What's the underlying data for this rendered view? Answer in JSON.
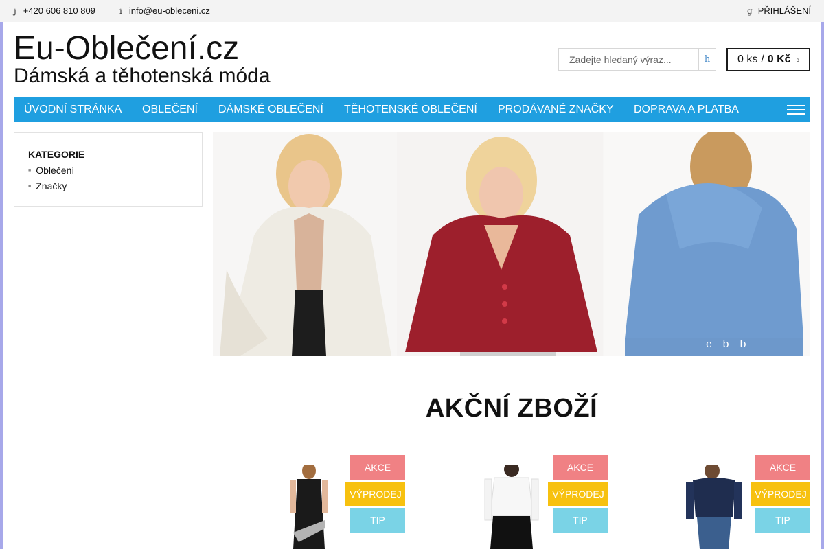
{
  "topbar": {
    "phone_icon": "j",
    "phone": "+420 606 810 809",
    "email_icon": "i",
    "email": "info@eu-obleceni.cz",
    "login_icon": "g",
    "login": "PŘIHLÁŠENÍ"
  },
  "header": {
    "title": "Eu-Oblečení.cz",
    "subtitle": "Dámská a těhotenská móda"
  },
  "search": {
    "placeholder": "Zadejte hledaný výraz...",
    "button_icon": "h"
  },
  "cart": {
    "count": "0 ks",
    "separator": "/",
    "total": "0 Kč",
    "icon": "d"
  },
  "nav": {
    "items": [
      {
        "label": "ÚVODNÍ STRÁNKA"
      },
      {
        "label": "OBLEČENÍ"
      },
      {
        "label": "DÁMSKÉ OBLEČENÍ"
      },
      {
        "label": "TĚHOTENSKÉ OBLEČENÍ"
      },
      {
        "label": "PRODÁVANÉ ZNAČKY"
      },
      {
        "label": "DOPRAVA A PLATBA"
      }
    ]
  },
  "sidebar": {
    "title": "KATEGORIE",
    "items": [
      {
        "label": "Oblečení"
      },
      {
        "label": "Značky"
      }
    ]
  },
  "banner": {
    "dots": [
      "e",
      "b",
      "b"
    ],
    "cardigans": [
      "white",
      "burgundy",
      "blue"
    ]
  },
  "section": {
    "title": "AKČNÍ ZBOŽÍ"
  },
  "products": [
    {
      "image": "black-dress",
      "badges": {
        "akce": "AKCE",
        "vyprodej": "VÝPRODEJ",
        "tip": "TIP"
      }
    },
    {
      "image": "white-blouse-black-skirt",
      "badges": {
        "akce": "AKCE",
        "vyprodej": "VÝPRODEJ",
        "tip": "TIP"
      }
    },
    {
      "image": "navy-sweater-jeans",
      "badges": {
        "akce": "AKCE",
        "vyprodej": "VÝPRODEJ",
        "tip": "TIP"
      }
    }
  ],
  "colors": {
    "nav_bg": "#1f9fe0",
    "akce": "#f08184",
    "vyprodej": "#f7c10f",
    "tip": "#7ad3e6",
    "side_accent": "#a7a8ea"
  }
}
